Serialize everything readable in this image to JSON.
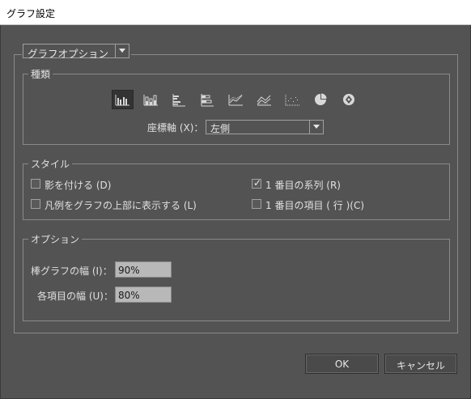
{
  "window": {
    "title": "グラフ設定"
  },
  "section_dropdown": {
    "value": "グラフオプション"
  },
  "type_group": {
    "legend": "種類",
    "icons": [
      "grouped-column-chart-icon",
      "stacked-column-chart-icon",
      "bar-chart-icon",
      "stacked-bar-chart-icon",
      "line-chart-icon",
      "area-chart-icon",
      "scatter-chart-icon",
      "pie-chart-icon",
      "radar-chart-icon"
    ],
    "selected_index": 0,
    "axis_label": "座標軸 (X)：",
    "axis_value": "左側"
  },
  "style_group": {
    "legend": "スタイル",
    "shadow": {
      "label": "影を付ける (D)",
      "checked": false
    },
    "legend_top": {
      "label": "凡例をグラフの上部に表示する (L)",
      "checked": false
    },
    "first_series": {
      "label": "1 番目の系列 (R)",
      "checked": true
    },
    "first_item": {
      "label": "1 番目の項目 ( 行 )(C)",
      "checked": false
    }
  },
  "options_group": {
    "legend": "オプション",
    "bar_width": {
      "label": "棒グラフの幅 (I)：",
      "value": "90%"
    },
    "item_width": {
      "label": "各項目の幅 (U)：",
      "value": "80%"
    }
  },
  "buttons": {
    "ok": "OK",
    "cancel": "キャンセル"
  },
  "colors": {
    "dialog_bg": "#535353",
    "field_bg": "#b8b8b8",
    "selected_icon_bg": "#333333"
  }
}
